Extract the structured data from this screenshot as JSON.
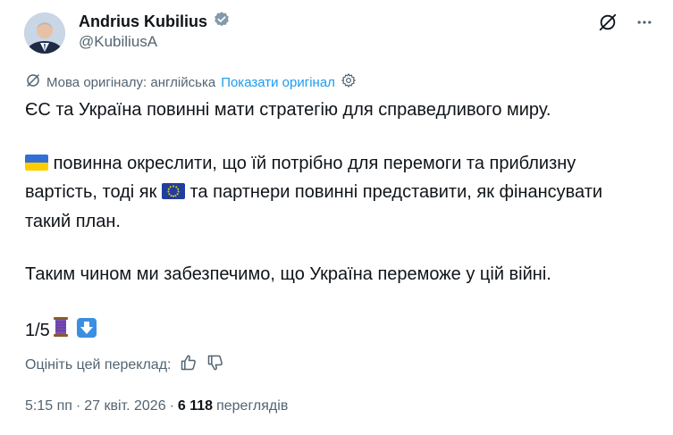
{
  "author": {
    "name": "Andrius Kubilius",
    "handle": "@KubiliusA",
    "verified": true
  },
  "translation": {
    "source_label": "Мова оригіналу: англійська",
    "show_original": "Показати оригінал"
  },
  "tweet": {
    "line1": "ЄС та Україна повинні мати стратегію для справедливого миру.",
    "para2_a": "повинна окреслити, що їй потрібно для перемоги та приблизну",
    "para2_b": "вартість, тоді як",
    "para2_c": "та партнери повинні представити, як фінансувати",
    "para2_d": "такий план.",
    "line3": "Таким чином ми забезпечимо, що Україна переможе у цій війні.",
    "counter": "1/5"
  },
  "rating": {
    "label": "Оцініть цей переклад:"
  },
  "meta": {
    "time": "5:15 пп",
    "separator": "·",
    "date": "27 квіт. 2026",
    "views_count": "6 118",
    "views_label": "переглядів"
  },
  "colors": {
    "accent": "#1d9bf0",
    "muted": "#536471",
    "text": "#0f1419"
  }
}
